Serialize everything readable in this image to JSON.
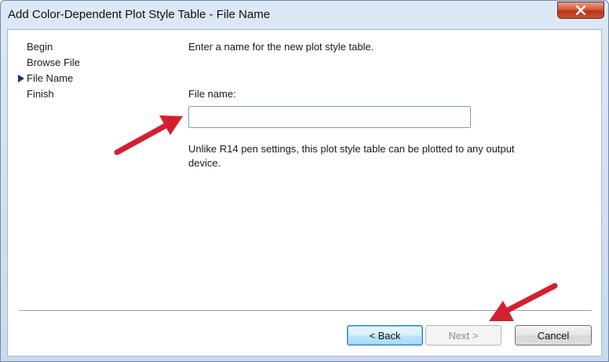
{
  "window": {
    "title": "Add Color-Dependent Plot Style Table - File Name"
  },
  "steps": [
    {
      "label": "Begin",
      "current": false
    },
    {
      "label": "Browse File",
      "current": false
    },
    {
      "label": "File Name",
      "current": true
    },
    {
      "label": "Finish",
      "current": false
    }
  ],
  "page": {
    "intro": "Enter a name for the new plot style table.",
    "file_name_label": "File name:",
    "file_name_value": "",
    "note": "Unlike R14 pen settings, this plot style table can be plotted to any output device."
  },
  "buttons": {
    "back": "< Back",
    "next": "Next >",
    "cancel": "Cancel"
  },
  "colors": {
    "annotation_arrow": "#d3202f",
    "step_marker": "#1a2f8a"
  },
  "icons": {
    "close": "close-icon",
    "step_marker": "current-step-marker-icon"
  }
}
